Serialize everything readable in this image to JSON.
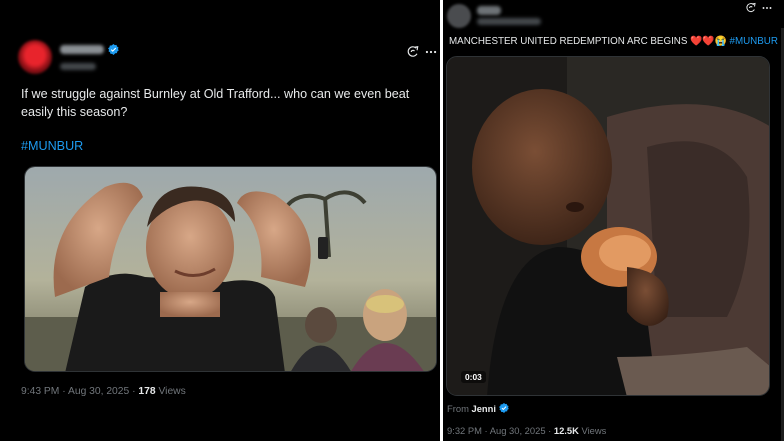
{
  "left_post": {
    "text": "If we struggle against Burnley at Old Trafford... who can we even beat easily this season?",
    "hashtag": "#MUNBUR",
    "time": "9:43 PM",
    "date": "Aug 30, 2025",
    "separator": "·",
    "views_count": "178",
    "views_label": "Views",
    "icons": [
      "grok-icon",
      "more-icon",
      "verified-badge-icon"
    ]
  },
  "right_post": {
    "text": "MANCHESTER UNITED REDEMPTION ARC BEGINS",
    "emojis": "❤️❤️😭",
    "hashtag": "#MUNBUR",
    "video_duration": "0:03",
    "from_label": "From",
    "from_account": "Jenni",
    "time": "9:32 PM",
    "date": "Aug 30, 2025",
    "separator": "·",
    "views_count": "12.5K",
    "views_label": "Views",
    "icons": [
      "grok-icon",
      "more-icon",
      "verified-badge-icon"
    ]
  },
  "colors": {
    "background": "#000000",
    "text": "#e7e9ea",
    "muted": "#71767b",
    "accent": "#1d9bf0",
    "divider": "#ffffff"
  }
}
